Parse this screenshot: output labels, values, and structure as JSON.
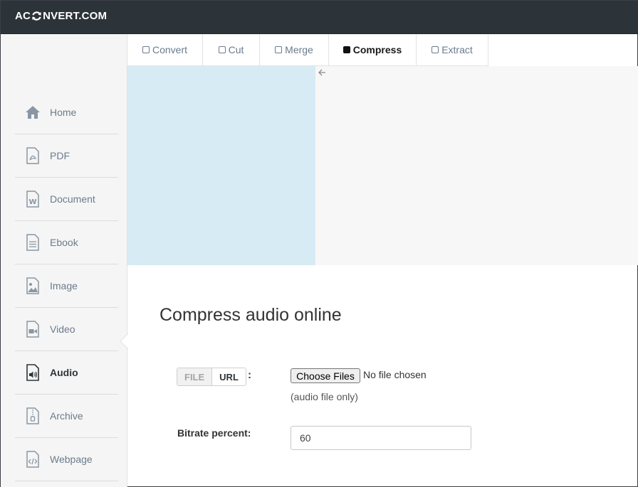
{
  "header": {
    "logo_left": "AC",
    "logo_right": "NVERT.COM"
  },
  "tabs": [
    {
      "label": "Convert",
      "active": false
    },
    {
      "label": "Cut",
      "active": false
    },
    {
      "label": "Merge",
      "active": false
    },
    {
      "label": "Compress",
      "active": true
    },
    {
      "label": "Extract",
      "active": false
    }
  ],
  "sidebar": {
    "items": [
      {
        "label": "Home",
        "icon": "home-icon"
      },
      {
        "label": "PDF",
        "icon": "pdf-file-icon"
      },
      {
        "label": "Document",
        "icon": "word-document-icon"
      },
      {
        "label": "Ebook",
        "icon": "ebook-icon"
      },
      {
        "label": "Image",
        "icon": "image-icon"
      },
      {
        "label": "Video",
        "icon": "video-icon"
      },
      {
        "label": "Audio",
        "icon": "audio-file-icon",
        "active": true
      },
      {
        "label": "Archive",
        "icon": "archive-icon"
      },
      {
        "label": "Webpage",
        "icon": "webpage-code-icon"
      }
    ]
  },
  "main": {
    "title": "Compress audio online",
    "source_toggle": {
      "file": "FILE",
      "url": "URL",
      "selected": "URL"
    },
    "file_button": "Choose Files",
    "no_file_text": "No file chosen",
    "file_hint": "(audio file only)",
    "bitrate_label": "Bitrate percent:",
    "bitrate_value": "60"
  },
  "colors": {
    "topbar": "#2d3439",
    "ad_left": "#d7ebf4",
    "sidebar_text": "#6b7b8c"
  }
}
